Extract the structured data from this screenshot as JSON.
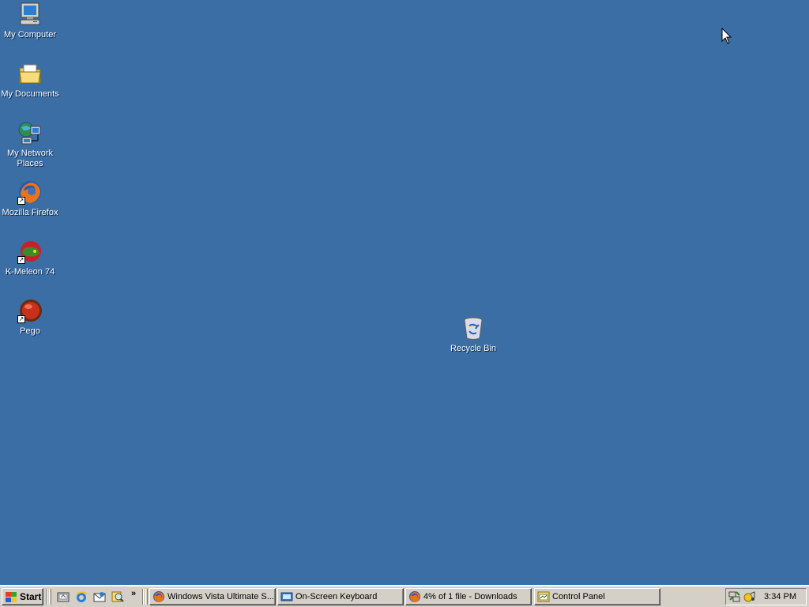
{
  "desktop": {
    "background_color": "#3a6ea5",
    "icons": [
      {
        "label": "My Computer",
        "icon": "computer-icon",
        "shortcut": false
      },
      {
        "label": "My Documents",
        "icon": "folder-icon",
        "shortcut": false
      },
      {
        "label": "My Network Places",
        "icon": "network-icon",
        "shortcut": false
      },
      {
        "label": "Mozilla Firefox",
        "icon": "firefox-icon",
        "shortcut": true
      },
      {
        "label": "K-Meleon 74",
        "icon": "kmeleon-icon",
        "shortcut": true
      },
      {
        "label": "Pego",
        "icon": "pego-icon",
        "shortcut": true
      },
      {
        "label": "Recycle Bin",
        "icon": "recycle-bin-icon",
        "shortcut": false
      }
    ]
  },
  "taskbar": {
    "start_label": "Start",
    "quick_launch": [
      "show-desktop-icon",
      "internet-explorer-icon",
      "outlook-express-icon",
      "search-icon"
    ],
    "overflow_label": "»",
    "tasks": [
      {
        "label": "Windows Vista Ultimate S...",
        "icon": "firefox-icon"
      },
      {
        "label": "On-Screen Keyboard",
        "icon": "keyboard-icon"
      },
      {
        "label": "4% of 1 file - Downloads",
        "icon": "firefox-icon"
      },
      {
        "label": "Control Panel",
        "icon": "control-panel-icon"
      }
    ],
    "tray": {
      "icons": [
        "network-tray-icon",
        "sound-tray-icon"
      ],
      "clock": "3:34 PM"
    }
  }
}
